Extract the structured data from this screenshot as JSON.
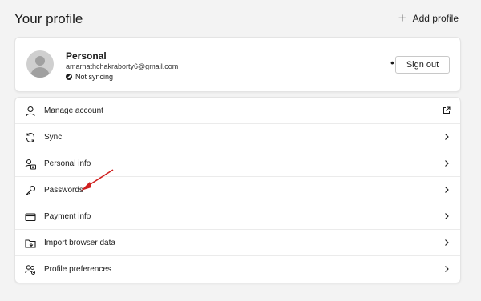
{
  "header": {
    "title": "Your profile",
    "add_profile_label": "Add profile"
  },
  "profile": {
    "name": "Personal",
    "email": "amarnathchakraborty6@gmail.com",
    "sync_status": "Not syncing",
    "more_label": "•••",
    "sign_out_label": "Sign out"
  },
  "menu": {
    "items": [
      {
        "label": "Manage account",
        "icon": "person-icon",
        "trailing": "external-link-icon"
      },
      {
        "label": "Sync",
        "icon": "sync-icon",
        "trailing": "chevron-right-icon"
      },
      {
        "label": "Personal info",
        "icon": "person-card-icon",
        "trailing": "chevron-right-icon"
      },
      {
        "label": "Passwords",
        "icon": "key-icon",
        "trailing": "chevron-right-icon"
      },
      {
        "label": "Payment info",
        "icon": "credit-card-icon",
        "trailing": "chevron-right-icon"
      },
      {
        "label": "Import browser data",
        "icon": "import-folder-icon",
        "trailing": "chevron-right-icon"
      },
      {
        "label": "Profile preferences",
        "icon": "people-settings-icon",
        "trailing": "chevron-right-icon"
      }
    ]
  },
  "colors": {
    "background": "#f3f3f3",
    "card": "#ffffff",
    "annotation_arrow": "#d0201f"
  }
}
